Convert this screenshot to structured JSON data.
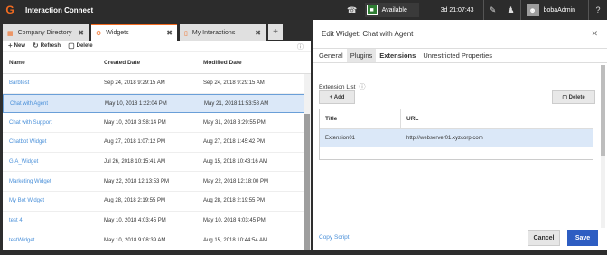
{
  "app": {
    "title": "Interaction Connect",
    "logo_glyph": "G"
  },
  "topbar": {
    "status": "Available",
    "timer": "3d 21:07:43",
    "username": "bobaAdmin",
    "icons": [
      "phone-icon",
      "edit-icon",
      "users-icon",
      "user-avatar-icon",
      "help-icon"
    ]
  },
  "tabs": [
    {
      "label": "Company Directory"
    },
    {
      "label": "Widgets"
    },
    {
      "label": "My Interactions"
    }
  ],
  "toolbar": {
    "new": "New",
    "refresh": "Refresh",
    "delete": "Delete"
  },
  "grid": {
    "headers": {
      "name": "Name",
      "created": "Created Date",
      "modified": "Modified Date"
    },
    "rows": [
      {
        "name": "Barbtest",
        "created": "Sep 24, 2018 9:29:15 AM",
        "modified": "Sep 24, 2018 9:29:15 AM"
      },
      {
        "name": "Chat with Agent",
        "created": "May 10, 2018 1:22:04 PM",
        "modified": "May 21, 2018 11:53:58 AM"
      },
      {
        "name": "Chat with Support",
        "created": "May 10, 2018 3:58:14 PM",
        "modified": "May 31, 2018 3:29:55 PM"
      },
      {
        "name": "Chatbot Widget",
        "created": "Aug 27, 2018 1:07:12 PM",
        "modified": "Aug 27, 2018 1:45:42 PM"
      },
      {
        "name": "GIA_Widget",
        "created": "Jul 26, 2018 10:15:41 AM",
        "modified": "Aug 15, 2018 10:43:16 AM"
      },
      {
        "name": "Marketing Widget",
        "created": "May 22, 2018 12:13:53 PM",
        "modified": "May 22, 2018 12:18:00 PM"
      },
      {
        "name": "My Bot Widget",
        "created": "Aug 28, 2018 2:19:55 PM",
        "modified": "Aug 28, 2018 2:19:55 PM"
      },
      {
        "name": "test 4",
        "created": "May 10, 2018 4:03:45 PM",
        "modified": "May 10, 2018 4:03:45 PM"
      },
      {
        "name": "testWidget",
        "created": "May 10, 2018 9:08:39 AM",
        "modified": "Aug 15, 2018 10:44:54 AM"
      }
    ]
  },
  "editor": {
    "title": "Edit Widget: Chat with Agent",
    "tabs": [
      "General",
      "Plugins",
      "Extensions",
      "Unrestricted Properties"
    ],
    "extension_list_label": "Extension List",
    "add_label": "Add",
    "delete_label": "Delete",
    "table_headers": {
      "title": "Title",
      "url": "URL"
    },
    "extensions": [
      {
        "title": "Extension01",
        "url": "http://webserver01.xyzcorp.com"
      }
    ],
    "copy_script": "Copy Script",
    "cancel": "Cancel",
    "save": "Save"
  }
}
